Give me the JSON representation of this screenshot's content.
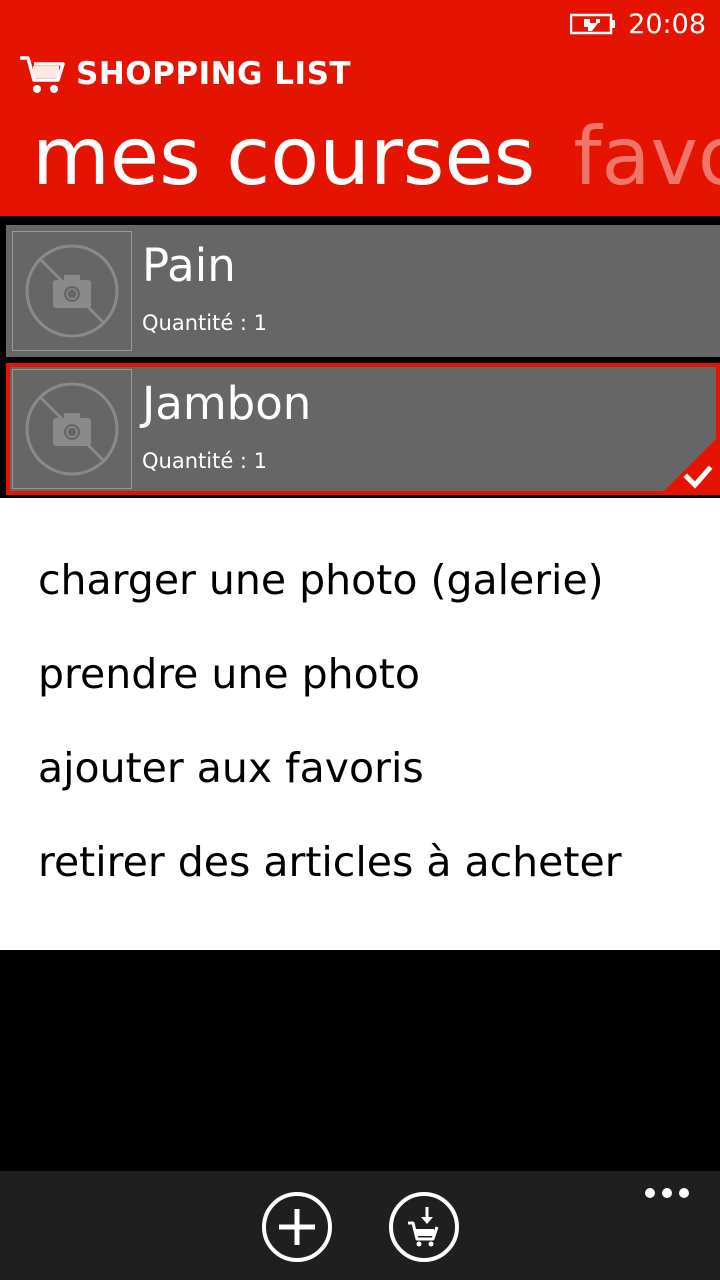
{
  "status": {
    "time": "20:08",
    "battery_icon": "battery-charging-icon"
  },
  "app": {
    "title": "SHOPPING LIST",
    "logo_icon": "shopping-cart-icon",
    "accent_color": "#e51400"
  },
  "pivot": {
    "active": "mes courses",
    "next": "favor"
  },
  "items": [
    {
      "name": "Pain",
      "quantity": "Quantité : 1",
      "image_icon": "no-photo-icon",
      "selected": false
    },
    {
      "name": "Jambon",
      "quantity": "Quantité : 1",
      "image_icon": "no-photo-icon",
      "selected": true
    }
  ],
  "context_menu": [
    "charger une photo (galerie)",
    "prendre une photo",
    "ajouter aux favoris",
    "retirer des articles à acheter"
  ],
  "app_bar": {
    "buttons": [
      "add-icon",
      "cart-download-icon"
    ],
    "more_icon": "more-dots-icon"
  }
}
